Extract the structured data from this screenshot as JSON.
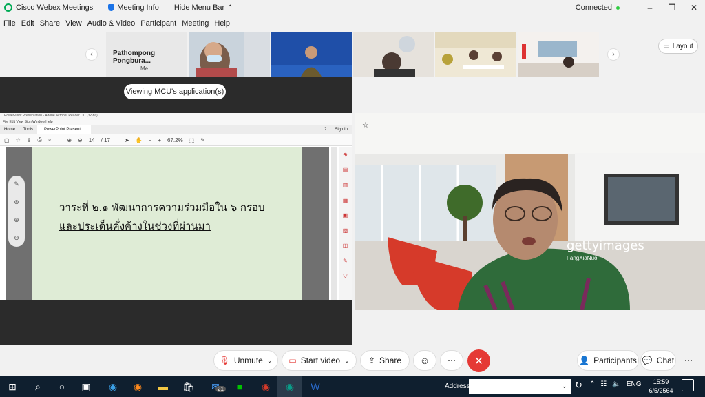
{
  "titlebar": {
    "app_name": "Cisco Webex Meetings",
    "meeting_info": "Meeting Info",
    "hide_menu_bar": "Hide Menu Bar",
    "status": "Connected"
  },
  "menu": [
    "File",
    "Edit",
    "Share",
    "View",
    "Audio & Video",
    "Participant",
    "Meeting",
    "Help"
  ],
  "strip": {
    "self_name": "Pathompong Pongbura...",
    "self_label": "Me",
    "layout_label": "Layout"
  },
  "share": {
    "viewing_label": "Viewing MCU's application(s)"
  },
  "acrobat": {
    "window_title": "PowerPoint Presentation - Adobe Acrobat Reader DC (32-bit)",
    "menu": [
      "File",
      "Edit",
      "View",
      "Sign",
      "Window",
      "Help"
    ],
    "tabs": [
      "Home",
      "Tools",
      "PowerPoint Present..."
    ],
    "sign_in": "Sign In",
    "page_current": "14",
    "page_total": "/ 17",
    "zoom": "67.2%"
  },
  "slide": {
    "line1": "วาระที่ ๒.๑ พัฒนาการความร่วมมือใน ๖ กรอบ",
    "line2": "และประเด็นคั่งค้างในช่วงที่ผ่านมา"
  },
  "speaker": {
    "watermark": "gettyimages",
    "credit": "FangXiaNuo"
  },
  "controls": {
    "unmute": "Unmute",
    "start_video": "Start video",
    "share": "Share",
    "participants": "Participants",
    "chat": "Chat"
  },
  "taskbar": {
    "address_label": "Address",
    "language": "ENG",
    "time": "15:59",
    "date": "6/5/2564",
    "mail_badge": "21"
  },
  "colors": {
    "leave": "#e53935",
    "taskbar": "#0f1f2f",
    "slide_bg": "#dfecd6"
  }
}
